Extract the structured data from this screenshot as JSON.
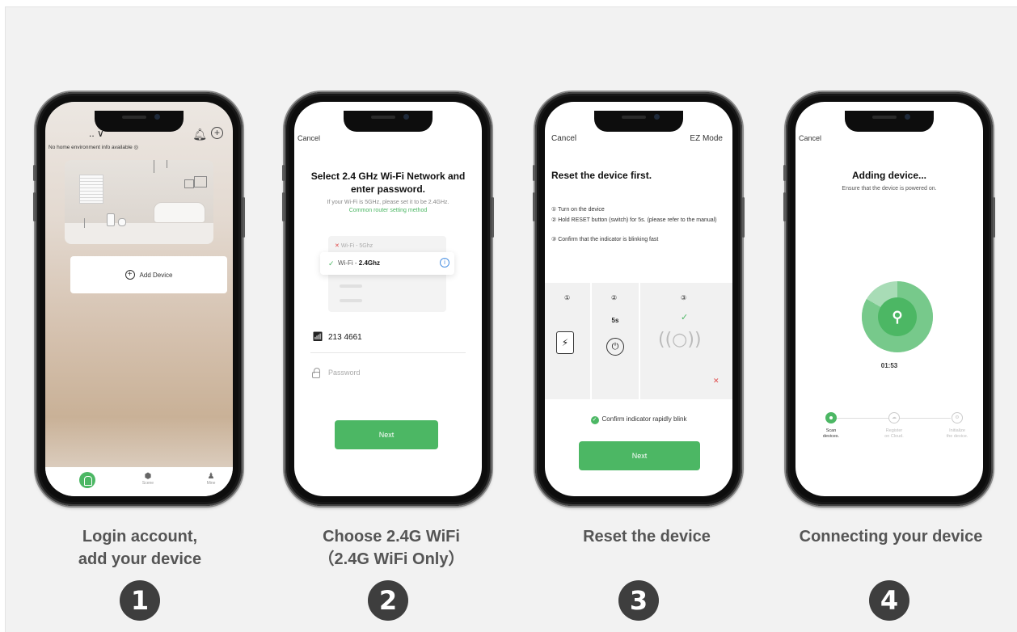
{
  "colors": {
    "accent": "#4cb764",
    "panel_bg": "#f2f2f2",
    "caption": "#555555",
    "badge": "#3e3e3e"
  },
  "steps": [
    {
      "number": "1",
      "caption_line1": "Login account,",
      "caption_line2": "add your device"
    },
    {
      "number": "2",
      "caption_line1": "Choose 2.4G WiFi",
      "caption_line2": "（2.4G WiFi Only）"
    },
    {
      "number": "3",
      "caption_line1": "Reset the device",
      "caption_line2": ""
    },
    {
      "number": "4",
      "caption_line1": "Connecting your device",
      "caption_line2": ""
    }
  ],
  "screen1": {
    "home_label": ".. ∨",
    "env_text": "No home environment info available",
    "add_device": "Add Device",
    "tabs": [
      "",
      "Scene",
      "Mine"
    ]
  },
  "screen2": {
    "cancel": "Cancel",
    "title_line1": "Select 2.4 GHz Wi-Fi Network and",
    "title_line2": "enter password.",
    "hint": "If your Wi-Fi is 5GHz, please set it to be 2.4GHz.",
    "router_link": "Common router setting method",
    "wifi_5g": "Wi-Fi - 5Ghz",
    "wifi_24_prefix": "Wi-Fi - ",
    "wifi_24_bold": "2.4Ghz",
    "ssid": "213 4661",
    "password_placeholder": "Password",
    "next": "Next"
  },
  "screen3": {
    "cancel": "Cancel",
    "mode": "EZ Mode",
    "title": "Reset the device first.",
    "step1": "① Turn on the device",
    "step2": "② Hold RESET button (switch) for 5s. (please refer to the manual)",
    "step3": "③ Confirm that the indicator is blinking fast",
    "pic_nums": [
      "①",
      "②",
      "③"
    ],
    "duration": "5s",
    "confirm": "Confirm indicator rapidly blink",
    "next": "Next"
  },
  "screen4": {
    "cancel": "Cancel",
    "title": "Adding device...",
    "subtitle": "Ensure that the device is powered on.",
    "timer": "01:53",
    "progress": [
      {
        "line1": "Scan",
        "line2": "devices."
      },
      {
        "line1": "Register",
        "line2": "on Cloud."
      },
      {
        "line1": "Initialize",
        "line2": "the device."
      }
    ]
  }
}
